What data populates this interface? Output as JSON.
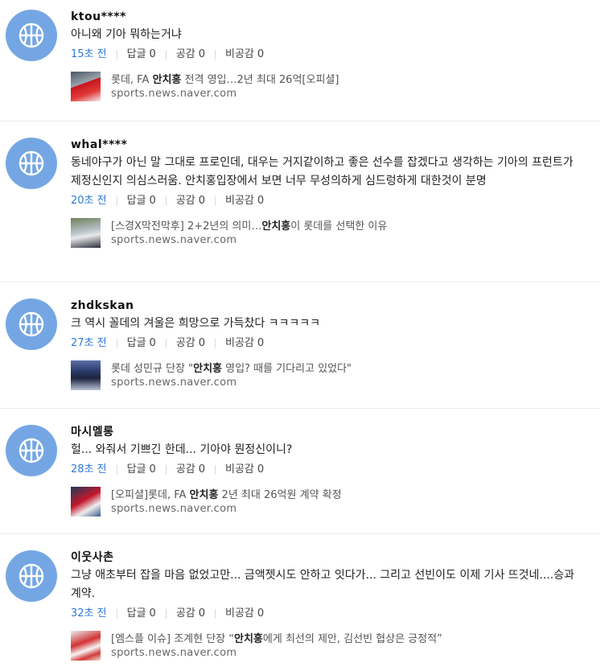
{
  "comments": [
    {
      "nickname": "ktou****",
      "text": "아니왜 기아 뭐하는거냐",
      "time": "15초 전",
      "reply_label": "답글",
      "reply_count": "0",
      "like_label": "공감",
      "like_count": "0",
      "dislike_label": "비공감",
      "dislike_count": "0",
      "news_pre": "롯데, FA ",
      "news_bold": "안치홍",
      "news_post": " 전격 영입…2년 최대 26억[오피셜]",
      "news_source": "sports.news.naver.com"
    },
    {
      "nickname": "whal****",
      "text": "동네야구가 아닌 말 그대로 프로인데, 대우는 거지같이하고 좋은 선수를 잡겠다고 생각하는 기아의 프런트가 제정신인지 의심스러움. 안치홍입장에서 보면 너무 무성의하게 심드렁하게 대한것이 분명",
      "time": "20초 전",
      "reply_label": "답글",
      "reply_count": "0",
      "like_label": "공감",
      "like_count": "0",
      "dislike_label": "비공감",
      "dislike_count": "0",
      "news_pre": "[스경X막전막후] 2+2년의 의미…",
      "news_bold": "안치홍",
      "news_post": "이 롯데를 선택한 이유",
      "news_source": "sports.news.naver.com"
    },
    {
      "nickname": "zhdkskan",
      "text": "크 역시 꼴데의 겨울은 희망으로 가득찼다 ㅋㅋㅋㅋㅋ",
      "time": "27초 전",
      "reply_label": "답글",
      "reply_count": "0",
      "like_label": "공감",
      "like_count": "0",
      "dislike_label": "비공감",
      "dislike_count": "0",
      "news_pre": "롯데 성민규 단장 \"",
      "news_bold": "안치홍",
      "news_post": " 영입? 때를 기다리고 있었다\"",
      "news_source": "sports.news.naver.com"
    },
    {
      "nickname": "마시멜롱",
      "text": "헐... 와줘서 기쁘긴 한데... 기아야 뭔정신이니?",
      "time": "28초 전",
      "reply_label": "답글",
      "reply_count": "0",
      "like_label": "공감",
      "like_count": "0",
      "dislike_label": "비공감",
      "dislike_count": "0",
      "news_pre": "[오피셜]롯데, FA ",
      "news_bold": "안치홍",
      "news_post": " 2년 최대 26억원 계약 확정",
      "news_source": "sports.news.naver.com"
    },
    {
      "nickname": "이웃사촌",
      "text": "그냥 애초부터 잡을 마음 없었고만... 금액젯시도 안하고 잇다가... 그리고 선빈이도 이제 기사 뜨것네....승과 계약.",
      "time": "32초 전",
      "reply_label": "답글",
      "reply_count": "0",
      "like_label": "공감",
      "like_count": "0",
      "dislike_label": "비공감",
      "dislike_count": "0",
      "news_pre": "[엠스플 이슈] 조계현 단장 “",
      "news_bold": "안치홍",
      "news_post": "에게 최선의 제안, 김선빈 협상은 긍정적”",
      "news_source": "sports.news.naver.com"
    }
  ]
}
